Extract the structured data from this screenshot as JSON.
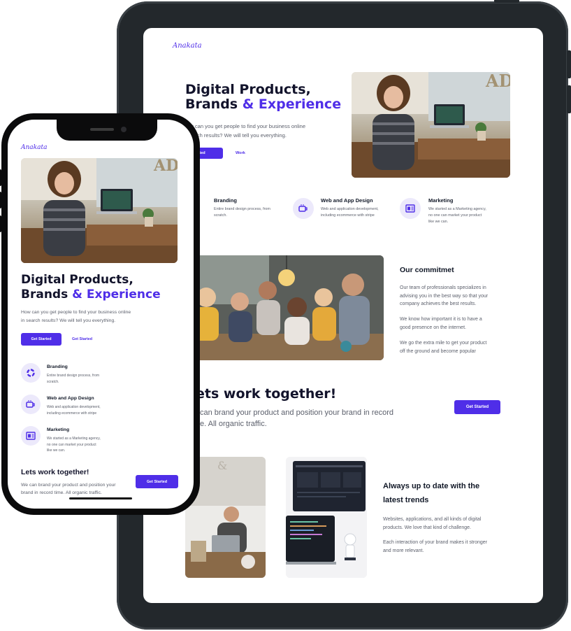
{
  "brand": {
    "logo": "Anakata",
    "accent": "#4f2ee8",
    "dark": "#12132b"
  },
  "hero": {
    "title_line1": "Digital Products,",
    "title_line2_plain": "Brands ",
    "title_line2_accent": "& Experience",
    "subtitle_tablet_line1": "ow can you get people to find your business online",
    "subtitle_tablet_line2": "search results? We will tell you everything.",
    "subtitle_phone_line1": "How can you get people to find your business online",
    "subtitle_phone_line2": "in search results? We will tell you everything.",
    "primary_button_tablet": "t Started",
    "primary_button": "Get Started",
    "secondary_button_tablet": "Work",
    "secondary_button_phone": "Get Started"
  },
  "services": [
    {
      "icon": "pie-chart-icon",
      "title": "Branding",
      "desc_line1": "Entire brand design process, from",
      "desc_line2": "scratch."
    },
    {
      "icon": "coffee-cup-icon",
      "title": "Web and App Design",
      "desc_line1": "Web and application development,",
      "desc_line2": "including ecommerce with stripe"
    },
    {
      "icon": "card-icon",
      "title": "Marketing",
      "desc_line1": "We started as a Marketing agency,",
      "desc_line2": "no one can market your product",
      "desc_line3": "like we can."
    }
  ],
  "commitment": {
    "title": "Our commitmet",
    "p1_line1": "Our team of professionals specializes in",
    "p1_line2": "advising you in the best way so that your",
    "p1_line3": "company achieves the best results.",
    "p2_line1": "We know how important it is to have a",
    "p2_line2": "good presence on the internet.",
    "p3_line1": "We go the extra mile to get your product",
    "p3_line2": "off the ground and become popular"
  },
  "cta": {
    "title_tablet": "ets work together!",
    "title_phone": "Lets work together!",
    "text_tablet_line1": "can brand your product and position your brand in record",
    "text_tablet_line2": "e. All organic traffic.",
    "text_phone_line1": "We can brand your product and position your",
    "text_phone_line2": "brand in record time. All organic traffic.",
    "button": "Get Started"
  },
  "trends": {
    "title_line1": "Always up to date with the",
    "title_line2": "latest trends",
    "p1_line1": "Websites, applications, and all kinds of digital",
    "p1_line2": "products. We love that kind of challenge.",
    "p2_line1": "Each interaction of your brand makes it stronger",
    "p2_line2": "and more relevant."
  },
  "photo_badge": "AD"
}
